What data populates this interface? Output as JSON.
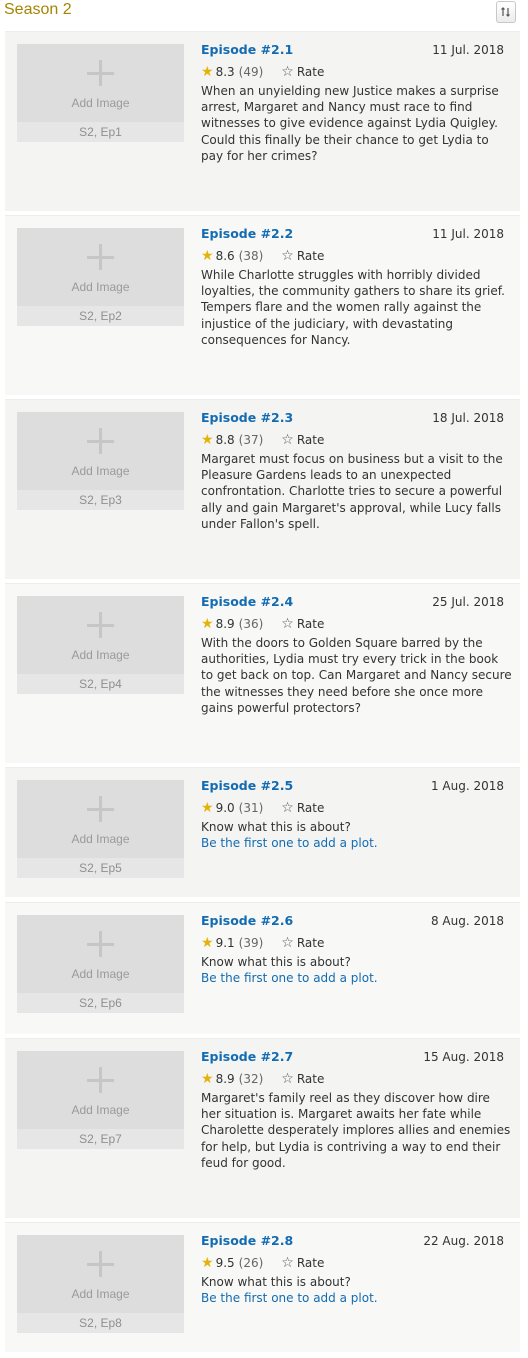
{
  "season_title": "Season 2",
  "thumb_label": "Add Image",
  "rate_label": "Rate",
  "episodes": [
    {
      "title": "Episode #2.1",
      "date": "11 Jul. 2018",
      "rating": "8.3",
      "votes": "(49)",
      "code": "S2, Ep1",
      "plot": "When an unyielding new Justice makes a surprise arrest, Margaret and Nancy must race to find witnesses to give evidence against Lydia Quigley. Could this finally be their chance to get Lydia to pay for her crimes?"
    },
    {
      "title": "Episode #2.2",
      "date": "11 Jul. 2018",
      "rating": "8.6",
      "votes": "(38)",
      "code": "S2, Ep2",
      "plot": "While Charlotte struggles with horribly divided loyalties, the community gathers to share its grief. Tempers flare and the women rally against the injustice of the judiciary, with devastating consequences for Nancy."
    },
    {
      "title": "Episode #2.3",
      "date": "18 Jul. 2018",
      "rating": "8.8",
      "votes": "(37)",
      "code": "S2, Ep3",
      "plot": "Margaret must focus on business but a visit to the Pleasure Gardens leads to an unexpected confrontation. Charlotte tries to secure a powerful ally and gain Margaret's approval, while Lucy falls under Fallon's spell."
    },
    {
      "title": "Episode #2.4",
      "date": "25 Jul. 2018",
      "rating": "8.9",
      "votes": "(36)",
      "code": "S2, Ep4",
      "plot": "With the doors to Golden Square barred by the authorities, Lydia must try every trick in the book to get back on top. Can Margaret and Nancy secure the witnesses they need before she once more gains powerful protectors?"
    },
    {
      "title": "Episode #2.5",
      "date": "1 Aug. 2018",
      "rating": "9.0",
      "votes": "(31)",
      "code": "S2, Ep5",
      "plot_question": "Know what this is about?",
      "plot_link": "Be the first one to add a plot."
    },
    {
      "title": "Episode #2.6",
      "date": "8 Aug. 2018",
      "rating": "9.1",
      "votes": "(39)",
      "code": "S2, Ep6",
      "plot_question": "Know what this is about?",
      "plot_link": "Be the first one to add a plot."
    },
    {
      "title": "Episode #2.7",
      "date": "15 Aug. 2018",
      "rating": "8.9",
      "votes": "(32)",
      "code": "S2, Ep7",
      "plot": "Margaret's family reel as they discover how dire her situation is. Margaret awaits her fate while Charolette desperately implores allies and enemies for help, but Lydia is contriving a way to end their feud for good."
    },
    {
      "title": "Episode #2.8",
      "date": "22 Aug. 2018",
      "rating": "9.5",
      "votes": "(26)",
      "code": "S2, Ep8",
      "plot_question": "Know what this is about?",
      "plot_link": "Be the first one to add a plot."
    }
  ],
  "colors": {
    "season_title": "#a58500",
    "link": "#136cb2",
    "star": "#e5b208"
  }
}
